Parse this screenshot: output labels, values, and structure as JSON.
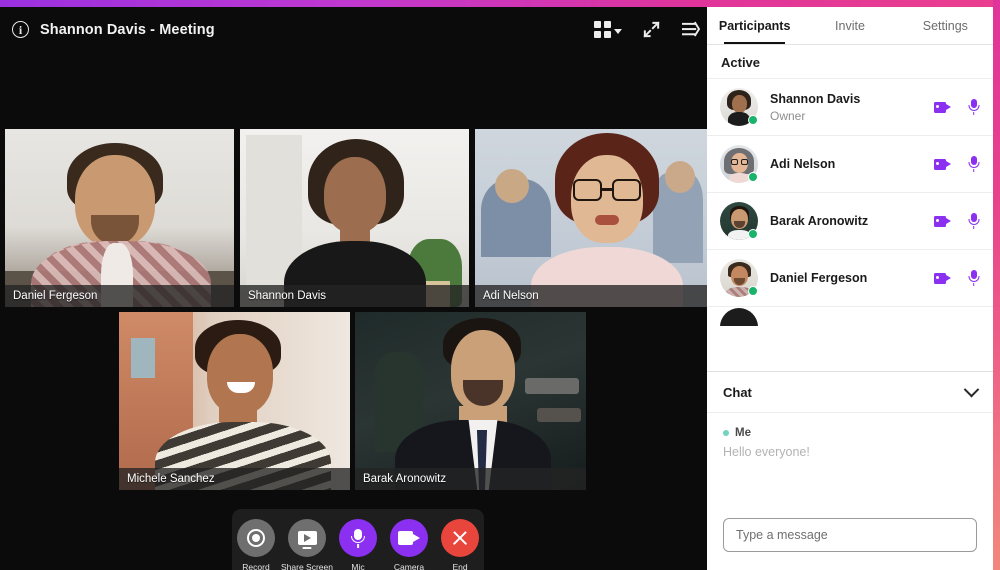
{
  "header": {
    "info_icon": "info-icon",
    "title": "Shannon Davis - Meeting",
    "actions": [
      {
        "name": "layout-grid",
        "icon": "grid-icon",
        "label": "Layout"
      },
      {
        "name": "fullscreen",
        "icon": "expand-arrows-icon",
        "label": "Fullscreen"
      },
      {
        "name": "collapse-panel",
        "icon": "collapse-panel-icon",
        "label": "Collapse panel"
      }
    ]
  },
  "video_tiles": [
    {
      "name": "Daniel Fergeson"
    },
    {
      "name": "Shannon Davis"
    },
    {
      "name": "Adi Nelson"
    },
    {
      "name": "Michele Sanchez"
    },
    {
      "name": "Barak Aronowitz"
    }
  ],
  "controls": [
    {
      "id": "record",
      "label": "Record",
      "icon": "record-icon",
      "style": "gray"
    },
    {
      "id": "share-screen",
      "label": "Share Screen",
      "icon": "screen-share-icon",
      "style": "gray"
    },
    {
      "id": "mic",
      "label": "Mic",
      "icon": "microphone-icon",
      "style": "purple"
    },
    {
      "id": "camera",
      "label": "Camera",
      "icon": "video-camera-icon",
      "style": "purple"
    },
    {
      "id": "end",
      "label": "End",
      "icon": "close-x-icon",
      "style": "red"
    }
  ],
  "sidebar": {
    "tabs": [
      {
        "label": "Participants",
        "active": true
      },
      {
        "label": "Invite",
        "active": false
      },
      {
        "label": "Settings",
        "active": false
      }
    ],
    "section_title": "Active",
    "participants": [
      {
        "name": "Shannon Davis",
        "role": "Owner",
        "online": true
      },
      {
        "name": "Adi Nelson",
        "role": "",
        "online": true
      },
      {
        "name": "Barak Aronowitz",
        "role": "",
        "online": true
      },
      {
        "name": "Daniel Fergeson",
        "role": "",
        "online": true
      }
    ],
    "participant_icons": {
      "camera": "video-camera-icon",
      "mic": "microphone-icon"
    },
    "chat": {
      "title": "Chat",
      "toggle_icon": "chevron-down-icon",
      "messages": [
        {
          "author": "Me",
          "text": "Hello everyone!"
        }
      ],
      "input_placeholder": "Type a message"
    }
  },
  "colors": {
    "accent_purple": "#8b2ff0",
    "end_red": "#e8453c",
    "online_green": "#19b36b",
    "frame_gradient_start": "#9b30e0",
    "frame_gradient_end": "#ea3f8f"
  }
}
